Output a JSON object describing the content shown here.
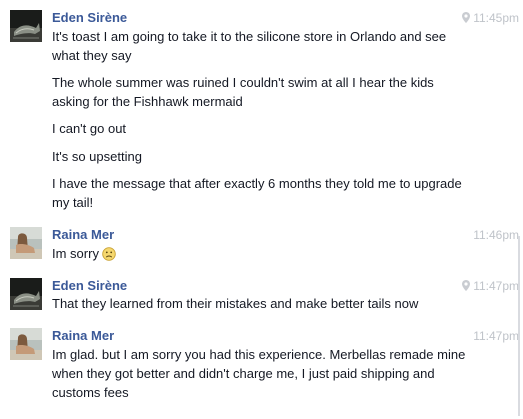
{
  "messages": [
    {
      "sender": "Eden Sirène",
      "time": "11:45pm",
      "has_location_pin": true,
      "avatar": "mermaid-tail-photo",
      "lines": [
        "It's toast I am going to take it to the silicone store in Orlando and see what they say",
        "The whole summer was ruined I couldn't swim at all I hear the kids asking for the Fishhawk mermaid",
        "I can't go out",
        "It's so upsetting",
        "I have the message that after exactly 6 months they told me to upgrade my tail!"
      ]
    },
    {
      "sender": "Raina Mer",
      "time": "11:46pm",
      "has_location_pin": false,
      "avatar": "person-on-beach-photo",
      "lines": [
        "Im sorry"
      ],
      "emoji": "frown-emoji"
    },
    {
      "sender": "Eden Sirène",
      "time": "11:47pm",
      "has_location_pin": true,
      "avatar": "mermaid-tail-photo",
      "lines": [
        "That they learned from their mistakes and make better tails now"
      ]
    },
    {
      "sender": "Raina Mer",
      "time": "11:47pm",
      "has_location_pin": false,
      "avatar": "person-on-beach-photo",
      "lines": [
        "Im glad. but I am sorry you had this experience. Merbellas remade mine when they got better and didn't charge me, I just paid shipping and customs fees"
      ]
    }
  ],
  "colors": {
    "sender_name": "#3b5998",
    "timestamp": "#bfc3c9",
    "message_text": "#141823",
    "emoji_fill": "#f5d76e"
  }
}
